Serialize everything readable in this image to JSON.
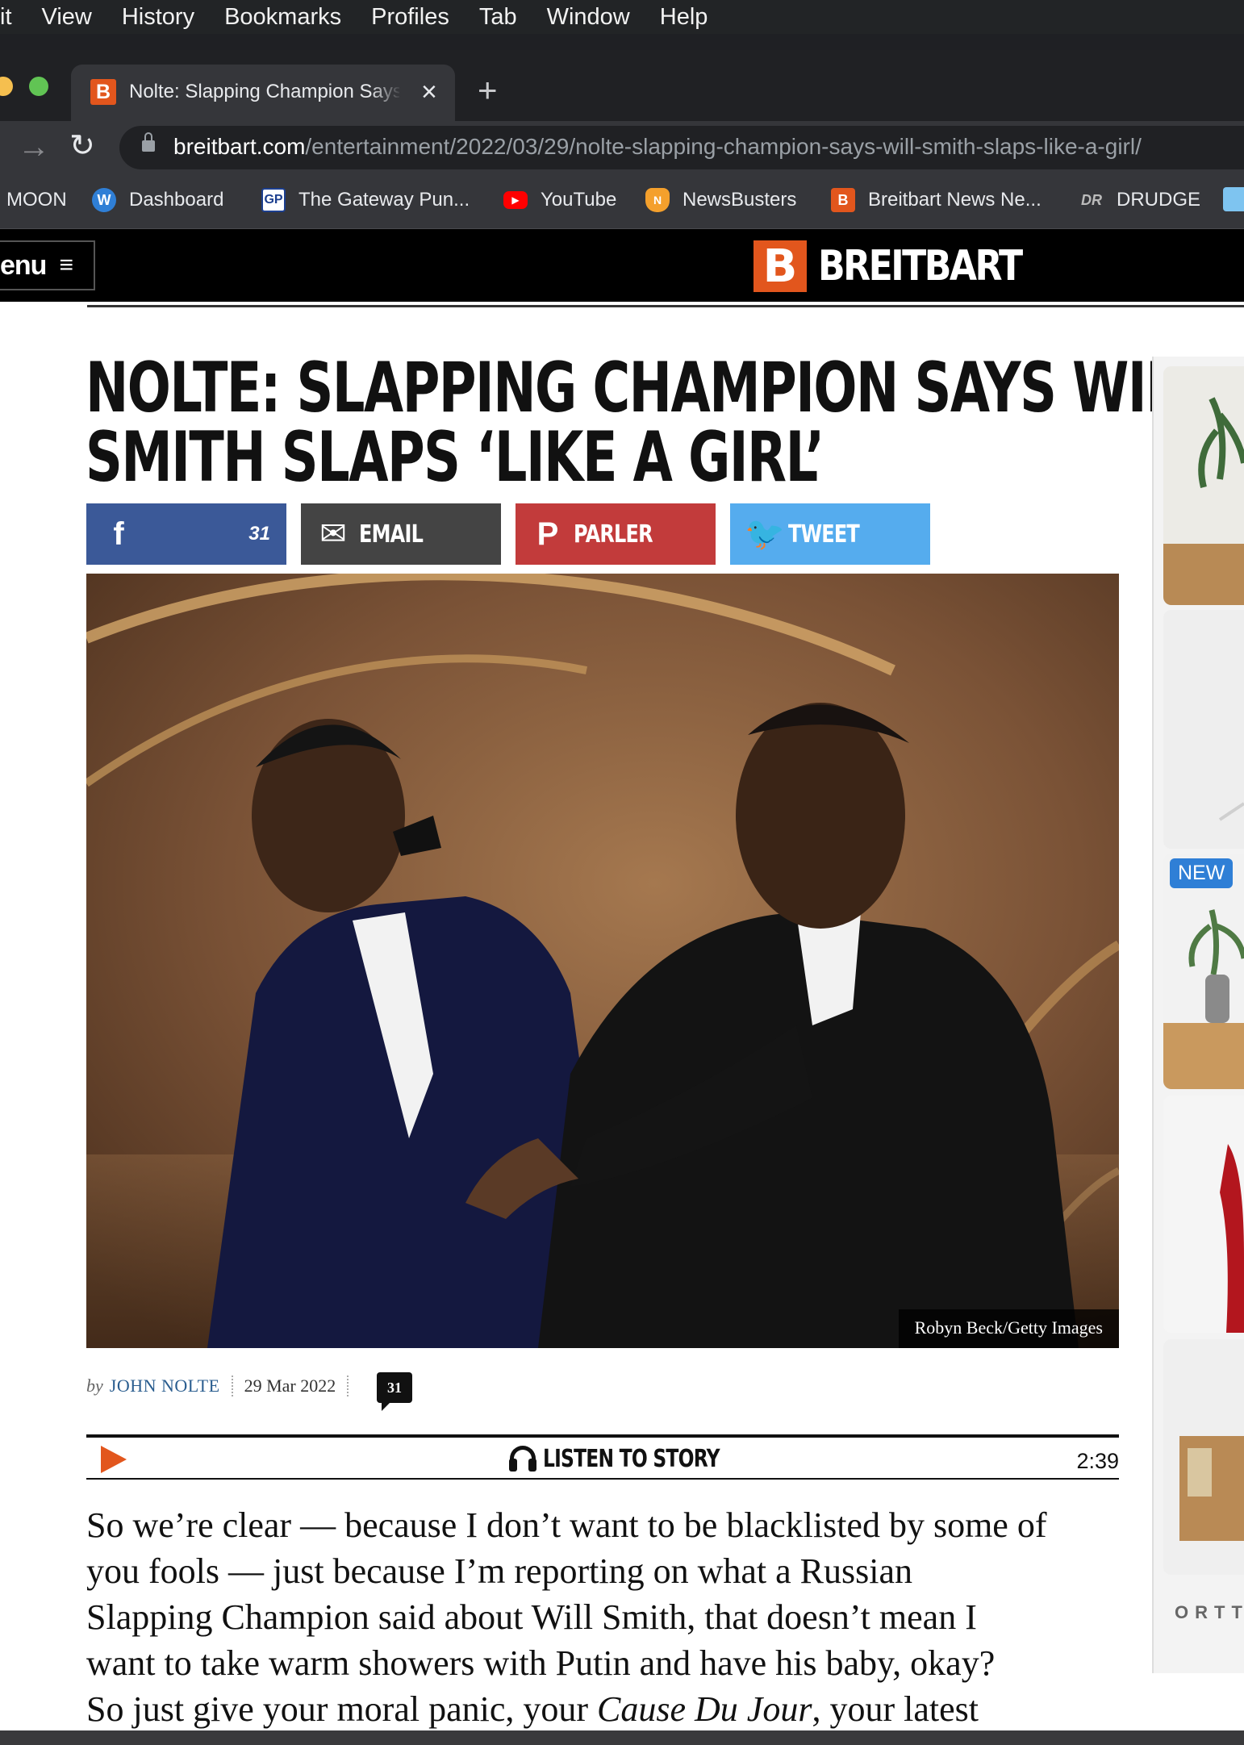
{
  "menubar": {
    "items": [
      "it",
      "View",
      "History",
      "Bookmarks",
      "Profiles",
      "Tab",
      "Window",
      "Help"
    ]
  },
  "browser": {
    "tab": {
      "favicon": "B",
      "title": "Nolte: Slapping Champion Says Will Smith Slaps Like a Girl",
      "close": "×",
      "new_tab": "+"
    },
    "toolbar": {
      "forward_icon": "→",
      "reload_icon": "↻",
      "url_host": "breitbart.com",
      "url_path": "/entertainment/2022/03/29/nolte-slapping-champion-says-will-smith-slaps-like-a-girl/"
    },
    "bookmarks": [
      {
        "label": "MOON",
        "icon": "none"
      },
      {
        "label": "Dashboard",
        "icon": "wordpress-icon",
        "glyph": "W"
      },
      {
        "label": "The Gateway Pun...",
        "icon": "gateway-pundit-icon",
        "glyph": "GP"
      },
      {
        "label": "YouTube",
        "icon": "youtube-icon",
        "glyph": "▶"
      },
      {
        "label": "NewsBusters",
        "icon": "newsbusters-icon",
        "glyph": "N"
      },
      {
        "label": "Breitbart News Ne...",
        "icon": "breitbart-icon",
        "glyph": "B"
      },
      {
        "label": "DRUDGE",
        "icon": "drudge-icon",
        "glyph": "DR"
      }
    ]
  },
  "site": {
    "menu_label": "enu",
    "menu_icon": "≡",
    "brand_logo": "B",
    "brand_name": "BREITBART",
    "brand_color": "#e2561d"
  },
  "article": {
    "headline_lines": [
      "NOLTE: SLAPPING CHAMPION SAYS WILL",
      "SMITH SLAPS ‘LIKE A GIRL’"
    ],
    "share": {
      "facebook": {
        "icon": "f",
        "count": "31",
        "color": "#3b5998"
      },
      "email": {
        "icon": "✉",
        "label": "EMAIL",
        "color": "#444444"
      },
      "parler": {
        "icon": "P",
        "label": "PARLER",
        "color": "#c23b3b"
      },
      "twitter": {
        "icon": "🐦",
        "label": "TWEET",
        "color": "#55acee"
      }
    },
    "image_credit": "Robyn Beck/Getty Images",
    "byline": {
      "by": "by",
      "author": "JOHN NOLTE",
      "date": "29 Mar 2022",
      "comments": "31"
    },
    "player": {
      "label": "LISTEN TO STORY",
      "duration": "2:39"
    },
    "body_lines": [
      "So we’re clear — because I don’t want to be blacklisted by some of",
      "you fools — just because I’m reporting on what a Russian",
      "Slapping Champion said about Will Smith, that doesn’t mean I",
      "want to take warm showers with Putin and have his baby, okay?"
    ],
    "body_last_line": {
      "before": "So just give your moral panic, your ",
      "italic": "Cause Du Jour",
      "after": ", your latest"
    }
  },
  "ad_rail": {
    "badge": "NEW",
    "brand_fragment": "ORTT"
  }
}
